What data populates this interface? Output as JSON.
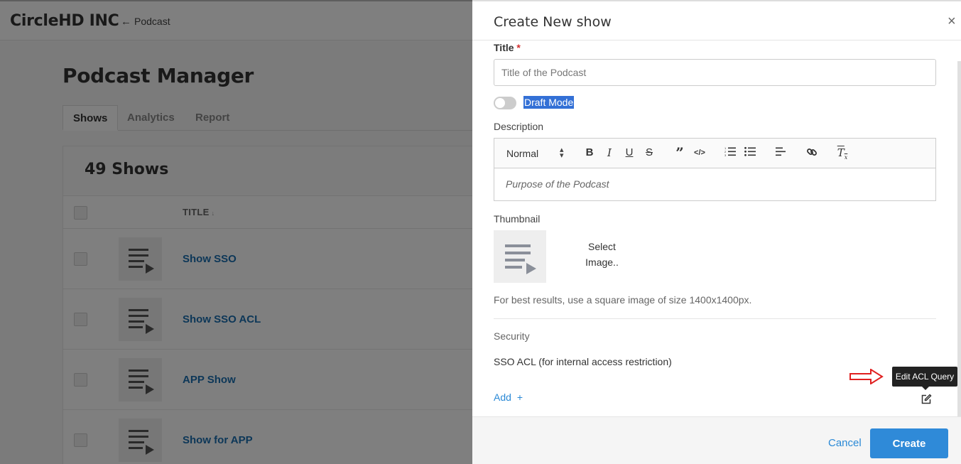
{
  "app": {
    "org_name": "CircleHD INC",
    "back_label": "Podcast"
  },
  "manager": {
    "title": "Podcast Manager",
    "tabs": [
      {
        "label": "Shows",
        "active": true
      },
      {
        "label": "Analytics",
        "active": false
      },
      {
        "label": "Report",
        "active": false
      }
    ],
    "count_label": "49 Shows",
    "column_title": "TITLE",
    "rows": [
      {
        "title": "Show SSO"
      },
      {
        "title": "Show SSO ACL"
      },
      {
        "title": "APP Show"
      },
      {
        "title": "Show for APP"
      }
    ]
  },
  "modal": {
    "title": "Create New show",
    "close_label": "×",
    "title_field": {
      "label": "Title",
      "required_mark": "*",
      "placeholder": "Title of the Podcast"
    },
    "draft_mode_label": "Draft Mode",
    "description": {
      "label": "Description",
      "format_select": "Normal",
      "placeholder": "Purpose of the Podcast"
    },
    "thumbnail": {
      "label": "Thumbnail",
      "select_line1": "Select",
      "select_line2": "Image..",
      "hint": "For best results, use a square image of size 1400x1400px."
    },
    "security": {
      "label": "Security",
      "acl_label": "SSO ACL (for internal access restriction)",
      "add_label": "Add",
      "tooltip": "Edit ACL Query"
    },
    "footer": {
      "cancel_label": "Cancel",
      "create_label": "Create"
    }
  },
  "colors": {
    "link": "#2a89d6",
    "primary_button": "#2f8ad8",
    "required": "#d32f2f",
    "selection_highlight": "#3370d6",
    "annotation_arrow": "#e02020"
  }
}
